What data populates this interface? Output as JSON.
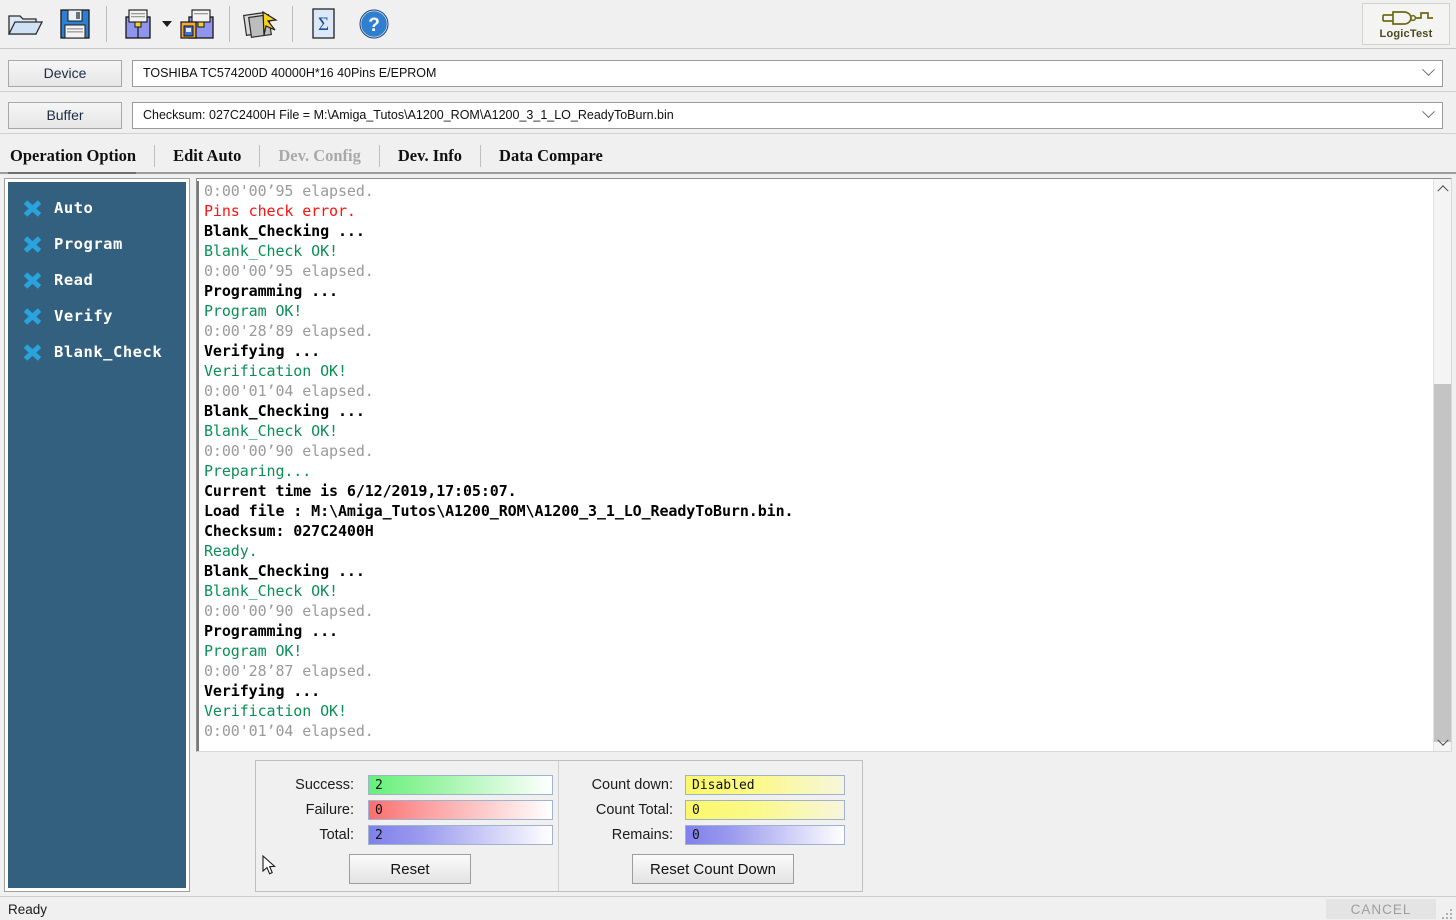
{
  "toolbar": {
    "buttons": [
      {
        "name": "open-folder-icon",
        "title": "Open"
      },
      {
        "name": "save-disk-icon",
        "title": "Save"
      },
      {
        "name": "load-buffer-icon",
        "title": "Load to Buffer"
      },
      {
        "name": "save-buffer-icon",
        "title": "Save Buffer"
      },
      {
        "name": "auto-program-icon",
        "title": "Auto"
      },
      {
        "name": "checksum-sigma-icon",
        "title": "Checksum"
      },
      {
        "name": "help-icon",
        "title": "Help"
      }
    ],
    "logo_text": "LogicTest"
  },
  "device_row": {
    "label": "Device",
    "value": "TOSHIBA  TC574200D  40000H*16  40Pins  E/EPROM"
  },
  "buffer_row": {
    "label": "Buffer",
    "value": "Checksum: 027C2400H   File = M:\\Amiga_Tutos\\A1200_ROM\\A1200_3_1_LO_ReadyToBurn.bin"
  },
  "tabs": [
    {
      "label": "Operation Option",
      "active": true,
      "disabled": false
    },
    {
      "label": "Edit Auto",
      "active": false,
      "disabled": false
    },
    {
      "label": "Dev. Config",
      "active": false,
      "disabled": true
    },
    {
      "label": "Dev. Info",
      "active": false,
      "disabled": false
    },
    {
      "label": "Data Compare",
      "active": false,
      "disabled": false
    }
  ],
  "sidebar": {
    "items": [
      {
        "label": "Auto"
      },
      {
        "label": "Program"
      },
      {
        "label": "Read"
      },
      {
        "label": "Verify"
      },
      {
        "label": "Blank_Check"
      }
    ],
    "background_color": "#33607f",
    "icon_color": "#2aa3dd"
  },
  "log": {
    "lines": [
      {
        "text": "0:00'00’95 elapsed.",
        "style": "gray"
      },
      {
        "text": "Pins check error.",
        "style": "red"
      },
      {
        "text": "Blank_Checking ...",
        "style": "black"
      },
      {
        "text": "Blank_Check OK!",
        "style": "green"
      },
      {
        "text": "0:00'00’95 elapsed.",
        "style": "gray"
      },
      {
        "text": "Programming ...",
        "style": "black"
      },
      {
        "text": "Program OK!",
        "style": "green"
      },
      {
        "text": "0:00'28’89 elapsed.",
        "style": "gray"
      },
      {
        "text": "Verifying ...",
        "style": "black"
      },
      {
        "text": "Verification OK!",
        "style": "green"
      },
      {
        "text": "0:00'01’04 elapsed.",
        "style": "gray"
      },
      {
        "text": "Blank_Checking ...",
        "style": "black"
      },
      {
        "text": "Blank_Check OK!",
        "style": "green"
      },
      {
        "text": "0:00'00’90 elapsed.",
        "style": "gray"
      },
      {
        "text": "Preparing...",
        "style": "green"
      },
      {
        "text": "Current time is 6/12/2019,17:05:07.",
        "style": "black"
      },
      {
        "text": "Load file : M:\\Amiga_Tutos\\A1200_ROM\\A1200_3_1_LO_ReadyToBurn.bin.",
        "style": "black"
      },
      {
        "text": "Checksum: 027C2400H",
        "style": "black"
      },
      {
        "text": "Ready.",
        "style": "green"
      },
      {
        "text": "Blank_Checking ...",
        "style": "black"
      },
      {
        "text": "Blank_Check OK!",
        "style": "green"
      },
      {
        "text": "0:00'00’90 elapsed.",
        "style": "gray"
      },
      {
        "text": "Programming ...",
        "style": "black"
      },
      {
        "text": "Program OK!",
        "style": "green"
      },
      {
        "text": "0:00'28’87 elapsed.",
        "style": "gray"
      },
      {
        "text": "Verifying ...",
        "style": "black"
      },
      {
        "text": "Verification OK!",
        "style": "green"
      },
      {
        "text": "0:00'01’04 elapsed.",
        "style": "gray"
      }
    ],
    "colors": {
      "black": "#000000",
      "gray": "#9a9a9a",
      "green": "#0a8f55",
      "red": "#ff1111"
    }
  },
  "counters": {
    "left": {
      "rows": [
        {
          "label": "Success:",
          "value": "2",
          "bar": "green"
        },
        {
          "label": "Failure:",
          "value": "0",
          "bar": "red"
        },
        {
          "label": "Total:",
          "value": "2",
          "bar": "blue"
        }
      ],
      "button": "Reset"
    },
    "right": {
      "rows": [
        {
          "label": "Count down:",
          "value": "Disabled",
          "bar": "yellow"
        },
        {
          "label": "Count Total:",
          "value": "0",
          "bar": "yellow"
        },
        {
          "label": "Remains:",
          "value": "0",
          "bar": "blue"
        }
      ],
      "button": "Reset Count Down"
    }
  },
  "statusbar": {
    "text": "Ready",
    "cancel_label": "CANCEL"
  }
}
